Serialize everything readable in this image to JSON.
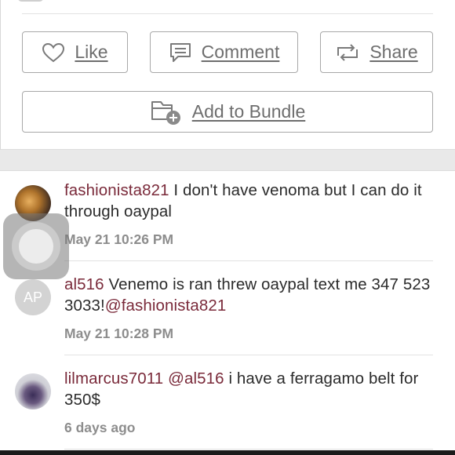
{
  "actions": {
    "like_label": "Like",
    "comment_label": "Comment",
    "share_label": "Share",
    "bundle_label": "Add to Bundle"
  },
  "comments": [
    {
      "username": "fashionista821",
      "text": "I don't have venoma but I can do it through oaypal",
      "mention": "",
      "timestamp": "May 21 10:26 PM",
      "avatar_initials": ""
    },
    {
      "username": "al516",
      "text": "Venemo is ran threw oaypal text me 347 523 3033!",
      "mention": "@fashionista821",
      "timestamp": "May 21 10:28 PM",
      "avatar_initials": "AP"
    },
    {
      "username": "lilmarcus7011",
      "mention_before": "@al516",
      "text": "i have a ferragamo belt for 350$",
      "timestamp": "6 days ago",
      "avatar_initials": ""
    }
  ],
  "colors": {
    "username": "#7a2a3a",
    "button_text": "#6e6e6e",
    "timestamp": "#8d8d8d"
  },
  "icons": [
    "heart-icon",
    "comment-icon",
    "share-icon",
    "bundle-icon"
  ]
}
